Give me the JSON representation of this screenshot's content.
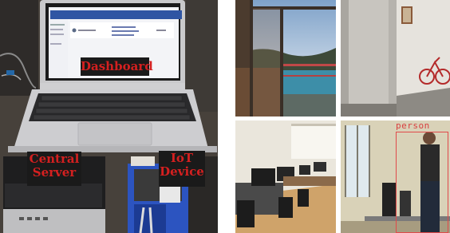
{
  "captions": {
    "dashboard": "Dashboard",
    "central_server_line1": "Central",
    "central_server_line2": "Server",
    "iot_device_line1": "IoT",
    "iot_device_line2": "Device"
  },
  "detection": {
    "label": "person",
    "box_color": "#e04a4a"
  },
  "caption_colors": {
    "text": "#d42020",
    "background": "#1a1a1a"
  }
}
